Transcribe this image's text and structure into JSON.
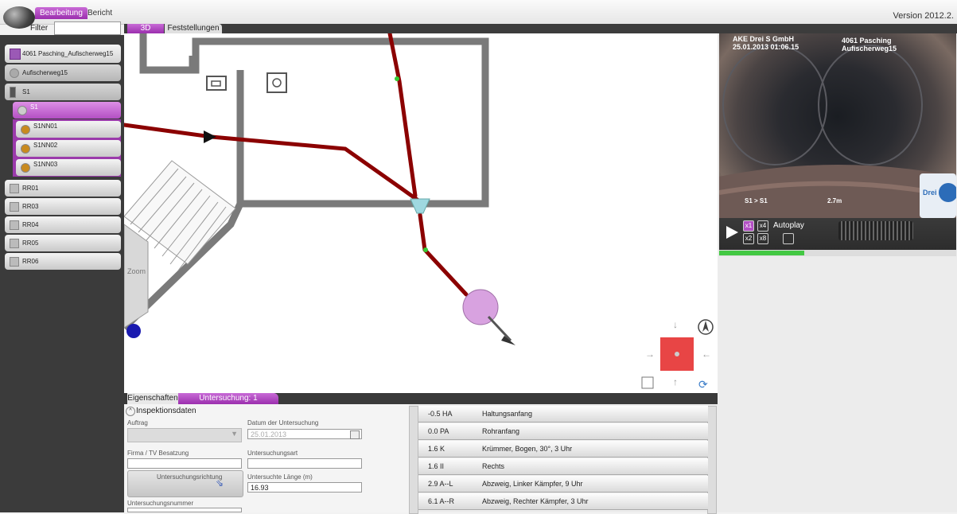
{
  "topbar": {
    "tabs": [
      "Bearbeitung",
      "Bericht"
    ],
    "filter_label": "Filter",
    "version": "Version  2012.2."
  },
  "view_tabs": [
    "3D",
    "Feststellungen"
  ],
  "tree": {
    "project": "4061 Pasching_Aufischerweg15",
    "street": "Aufischerweg15",
    "items": [
      "S1",
      "S1",
      "S1NN01",
      "S1NN02",
      "S1NN03",
      "RR01",
      "RR03",
      "RR04",
      "RR05",
      "RR06"
    ]
  },
  "viewport": {
    "zoom_label": "Zoom"
  },
  "video": {
    "company": "AKE Drei S GmbH",
    "date_time": "25.01.2013      01:06.15",
    "location_line1": "4061 Pasching",
    "location_line2": "Aufischerweg15",
    "section_label": "S1 > S1",
    "distance_label": "2.7m",
    "logo_text": "Drei",
    "progress": 0.36,
    "speeds": [
      "x1",
      "x4",
      "x2",
      "x8"
    ],
    "autoplay_label": "Autoplay"
  },
  "bottom_tabs": [
    "Eigenschaften",
    "Untersuchung: 1"
  ],
  "properties": {
    "section_title": "Inspektionsdaten",
    "auftrag_label": "Auftrag",
    "datum_label": "Datum der Untersuchung",
    "datum_value": "25.01.2013",
    "firma_label": "Firma / TV Besatzung",
    "untersuchungsart_label": "Untersuchungsart",
    "richtung_label": "Untersuchungsrichtung",
    "laenge_label": "Untersuchte Länge (m)",
    "laenge_value": "16.93",
    "nummer_label": "Untersuchungsnummer"
  },
  "findings": [
    {
      "code": "-0.5 HA",
      "desc": "Haltungsanfang"
    },
    {
      "code": "0.0 PA",
      "desc": "Rohranfang"
    },
    {
      "code": "1.6 K",
      "desc": "Krümmer, Bogen, 30°, 3 Uhr"
    },
    {
      "code": "1.6 II",
      "desc": "Rechts"
    },
    {
      "code": "2.9 A--L",
      "desc": "Abzweig, Linker Kämpfer, 9 Uhr"
    },
    {
      "code": "6.1 A--R",
      "desc": "Abzweig, Rechter Kämpfer, 3 Uhr"
    }
  ],
  "colors": {
    "accent": "#b34fc3",
    "pipe": "#8b0000",
    "compass_center": "#e84545",
    "progress": "#43c843"
  }
}
